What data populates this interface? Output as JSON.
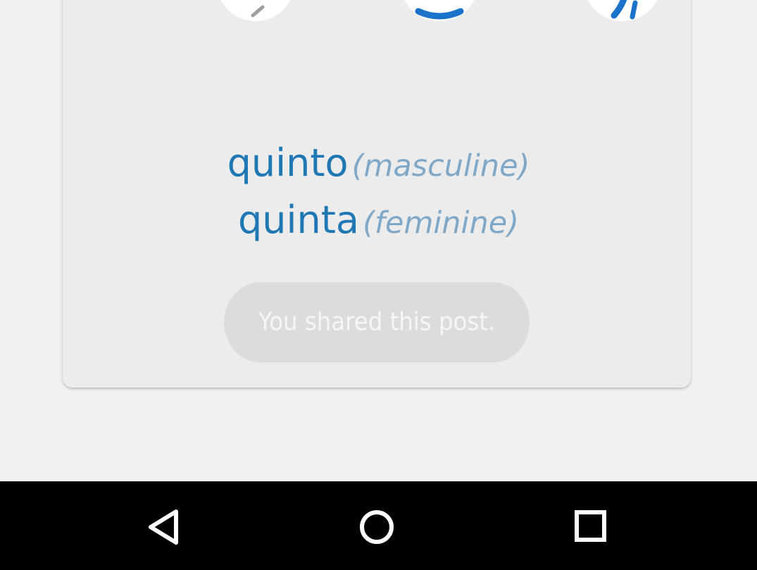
{
  "card": {
    "share_icons": [
      {
        "name": "share-target-1-icon"
      },
      {
        "name": "share-target-2-icon"
      },
      {
        "name": "share-target-3-icon"
      }
    ],
    "words": [
      {
        "word": "quinto",
        "gender": "(masculine)"
      },
      {
        "word": "quinta",
        "gender": "(feminine)"
      }
    ],
    "shared_button_label": "You shared this post."
  },
  "navbar": {
    "back_icon": "back-icon",
    "home_icon": "home-icon",
    "recents_icon": "recents-icon"
  },
  "colors": {
    "word": "#1f78b4",
    "gender": "#7fa8c8",
    "card_bg": "#ececec",
    "page_bg": "#f1f1f1",
    "shared_button_bg": "#dcdcdc",
    "navbar_bg": "#000000",
    "icon_accent": "#1a73c8"
  }
}
